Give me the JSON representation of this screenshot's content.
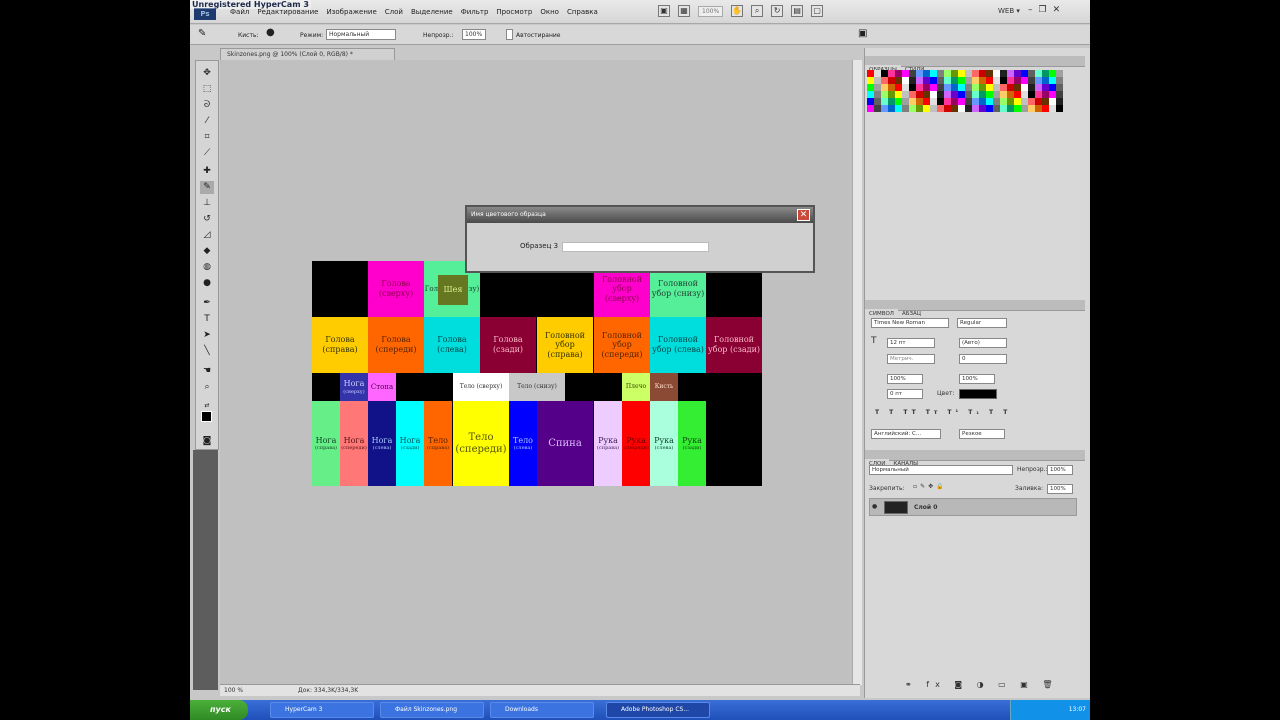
{
  "watermark": "Unregistered HyperCam 3",
  "app": {
    "logo": "Ps"
  },
  "menus": [
    "Файл",
    "Редактирование",
    "Изображение",
    "Слой",
    "Выделение",
    "Фильтр",
    "Просмотр",
    "Окно",
    "Справка"
  ],
  "menu_right": {
    "zoom": "100%",
    "workspace": "WEB",
    "workspace_caret": "▾"
  },
  "options": {
    "brush_label": "Кисть:",
    "mode_label": "Режим:",
    "mode_value": "Нормальный",
    "flow_label": "Непрозр.:",
    "flow_value": "100%",
    "auto_label": "Автостирание"
  },
  "doc_tab": "Skinzones.png @ 100% (Слой 0, RGB/8) *",
  "status": {
    "zoom": "100 %",
    "doc": "Док: 334,3K/334,3K"
  },
  "dialog": {
    "title": "Имя цветового образца",
    "label": "Образец 3",
    "close": "✕"
  },
  "canvas": {
    "cells": [
      {
        "id": "head-top",
        "color": "#ff00cc",
        "text": "Голова",
        "sub": "(сверху)",
        "tc": "#8a004a"
      },
      {
        "id": "neck",
        "color": "#55ee99",
        "text": "Голова (снизу)",
        "sub": "",
        "tc": "#204030"
      },
      {
        "id": "neck-inner",
        "color": "#667722",
        "text": "Шея",
        "sub": "",
        "tc": "#ddee88"
      },
      {
        "id": "hat-top",
        "color": "#ff00cc",
        "text": "Головной",
        "sub": "убор (сверху)",
        "tc": "#8a004a"
      },
      {
        "id": "hat-bottom",
        "color": "#55ee99",
        "text": "Головной",
        "sub": "убор (снизу)",
        "tc": "#204030"
      },
      {
        "id": "head-right",
        "color": "#ffcc00",
        "text": "Голова",
        "sub": "(справа)",
        "tc": "#333300"
      },
      {
        "id": "head-front",
        "color": "#ff6600",
        "text": "Голова",
        "sub": "(спереди)",
        "tc": "#552200"
      },
      {
        "id": "head-left",
        "color": "#00dddd",
        "text": "Голова",
        "sub": "(слева)",
        "tc": "#004444"
      },
      {
        "id": "head-back",
        "color": "#8a0033",
        "text": "Голова",
        "sub": "(сзади)",
        "tc": "#ffbbcc"
      },
      {
        "id": "hat-right",
        "color": "#ffcc00",
        "text": "Головной",
        "sub": "убор (справа)",
        "tc": "#333300"
      },
      {
        "id": "hat-front",
        "color": "#ff6600",
        "text": "Головной",
        "sub": "убор (спереди)",
        "tc": "#552200"
      },
      {
        "id": "hat-left",
        "color": "#00dddd",
        "text": "Головной",
        "sub": "убор (слева)",
        "tc": "#004444"
      },
      {
        "id": "hat-back",
        "color": "#8a0033",
        "text": "Головной",
        "sub": "убор (сзади)",
        "tc": "#ffbbcc"
      },
      {
        "id": "leg-top",
        "color": "#3333aa",
        "text": "Нога",
        "sub": "(сверху)",
        "tc": "#ccccff"
      },
      {
        "id": "foot",
        "color": "#ff66ff",
        "text": "Стопа",
        "sub": "",
        "tc": "#440044"
      },
      {
        "id": "body-top",
        "color": "#ffffff",
        "text": "Тело (сверху)",
        "sub": "",
        "tc": "#333"
      },
      {
        "id": "body-bottom",
        "color": "#c8c8c8",
        "text": "Тело (снизу)",
        "sub": "",
        "tc": "#333"
      },
      {
        "id": "shoulder",
        "color": "#ccff66",
        "text": "Плечо",
        "sub": "",
        "tc": "#334400"
      },
      {
        "id": "hand",
        "color": "#8a4a33",
        "text": "Кисть",
        "sub": "",
        "tc": "#ffddcc"
      },
      {
        "id": "leg-right",
        "color": "#66ee88",
        "text": "Нога",
        "sub": "(справа)",
        "tc": "#114422"
      },
      {
        "id": "leg-front",
        "color": "#ff7777",
        "text": "Нога",
        "sub": "(спереди)",
        "tc": "#551111"
      },
      {
        "id": "leg-left",
        "color": "#111188",
        "text": "Нога",
        "sub": "(слева)",
        "tc": "#aaccff"
      },
      {
        "id": "leg-back",
        "color": "#00ffff",
        "text": "Нога",
        "sub": "(сзади)",
        "tc": "#005555"
      },
      {
        "id": "body-right",
        "color": "#ff6600",
        "text": "Тело",
        "sub": "(справа)",
        "tc": "#552200"
      },
      {
        "id": "body-front",
        "color": "#ffff00",
        "text": "Тело",
        "sub": "(спереди)",
        "tc": "#555500"
      },
      {
        "id": "body-left",
        "color": "#0000ff",
        "text": "Тело",
        "sub": "(слева)",
        "tc": "#aaccff"
      },
      {
        "id": "back",
        "color": "#550088",
        "text": "Спина",
        "sub": "",
        "tc": "#ddbbff"
      },
      {
        "id": "arm-right",
        "color": "#eeccff",
        "text": "Рука",
        "sub": "(справа)",
        "tc": "#442255"
      },
      {
        "id": "arm-front",
        "color": "#ff0000",
        "text": "Рука",
        "sub": "(спереди)",
        "tc": "#660000"
      },
      {
        "id": "arm-left",
        "color": "#aaffdd",
        "text": "Рука",
        "sub": "(слева)",
        "tc": "#114433"
      },
      {
        "id": "arm-back",
        "color": "#33ee33",
        "text": "Рука",
        "sub": "(сзади)",
        "tc": "#114411"
      }
    ]
  },
  "panels": {
    "swatches_tabs": [
      "ОБРАЗЦЫ",
      "СТИЛИ"
    ],
    "char_tabs": [
      "СИМВОЛ",
      "АБЗАЦ"
    ],
    "font_family": "Times New Roman",
    "font_style": "Regular",
    "font_size": "12 пт",
    "leading": "(Авто)",
    "kerning": "Метрич.",
    "tracking": "0",
    "vscale": "100%",
    "hscale": "100%",
    "baseline": "0 пт",
    "color_label": "Цвет:",
    "lang": "Английский: С...",
    "aa": "Резкое",
    "layers_tabs": [
      "СЛОИ",
      "КАНАЛЫ"
    ],
    "blend": "Нормальный",
    "opacity_label": "Непрозр.:",
    "opacity": "100%",
    "lock_label": "Закрепить:",
    "fill_label": "Заливка:",
    "fill": "100%",
    "layer_name": "Слой 0"
  },
  "taskbar": {
    "start": "пуск",
    "tasks": [
      "HyperCam 3",
      "Файл Skinzones.png",
      "Downloads",
      "Adobe Photoshop CS..."
    ],
    "time": "13:07"
  },
  "swatch_colors": [
    "#ff0000",
    "#ffff00",
    "#00ff00",
    "#00ffff",
    "#0000ff",
    "#ff00ff",
    "#ffffff",
    "#e0e0e0",
    "#c0c0c0",
    "#a0a0a0",
    "#808080",
    "#606060",
    "#404040",
    "#202020",
    "#000000",
    "#ff6666",
    "#ffcc66",
    "#99ff66",
    "#66ffcc",
    "#6699ff",
    "#cc66ff",
    "#ff3399",
    "#cc0000",
    "#cc6600",
    "#669900",
    "#009966",
    "#0066cc",
    "#6600cc",
    "#990066",
    "#663300"
  ]
}
